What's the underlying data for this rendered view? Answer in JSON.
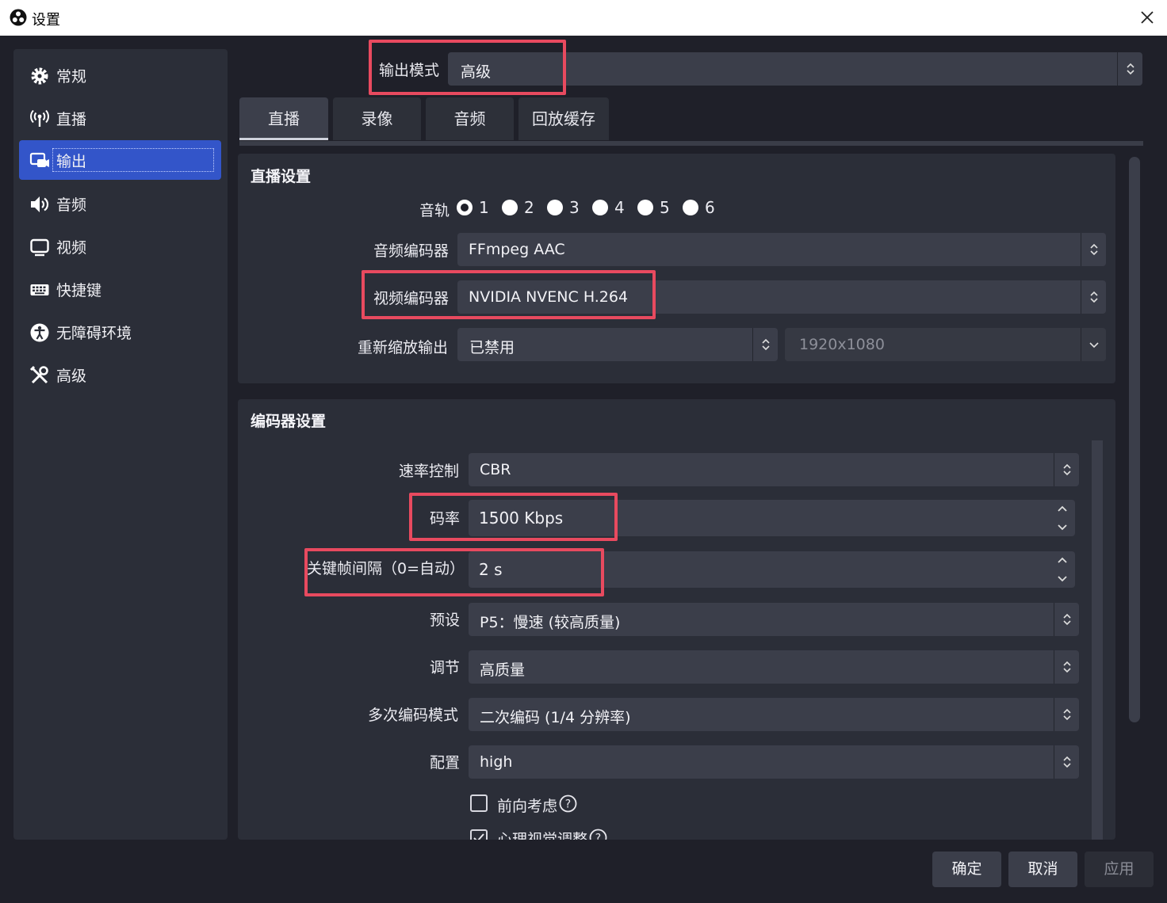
{
  "window": {
    "title": "设置"
  },
  "sidebar": {
    "items": [
      {
        "label": "常规"
      },
      {
        "label": "直播"
      },
      {
        "label": "输出"
      },
      {
        "label": "音频"
      },
      {
        "label": "视频"
      },
      {
        "label": "快捷键"
      },
      {
        "label": "无障碍环境"
      },
      {
        "label": "高级"
      }
    ]
  },
  "output_mode": {
    "label": "输出模式",
    "value": "高级"
  },
  "tabs": [
    {
      "label": "直播"
    },
    {
      "label": "录像"
    },
    {
      "label": "音频"
    },
    {
      "label": "回放缓存"
    }
  ],
  "stream_settings": {
    "title": "直播设置",
    "audio_track_label": "音轨",
    "tracks": [
      "1",
      "2",
      "3",
      "4",
      "5",
      "6"
    ],
    "audio_encoder": {
      "label": "音频编码器",
      "value": "FFmpeg AAC"
    },
    "video_encoder": {
      "label": "视频编码器",
      "value": "NVIDIA NVENC H.264"
    },
    "rescale": {
      "label": "重新缩放输出",
      "value": "已禁用",
      "resolution": "1920x1080"
    }
  },
  "encoder_settings": {
    "title": "编码器设置",
    "rate_control": {
      "label": "速率控制",
      "value": "CBR"
    },
    "bitrate": {
      "label": "码率",
      "value": "1500 Kbps"
    },
    "keyframe": {
      "label": "关键帧间隔（0=自动）",
      "value": "2 s"
    },
    "preset": {
      "label": "预设",
      "value": "P5：慢速 (较高质量)"
    },
    "tuning": {
      "label": "调节",
      "value": "高质量"
    },
    "multipass": {
      "label": "多次编码模式",
      "value": "二次编码 (1/4 分辨率)"
    },
    "profile": {
      "label": "配置",
      "value": "high"
    },
    "lookahead": {
      "label": "前向考虑"
    },
    "psycho": {
      "label": "心理视觉调整"
    }
  },
  "buttons": {
    "ok": "确定",
    "cancel": "取消",
    "apply": "应用"
  },
  "colors": {
    "accent": "#3355c9",
    "highlight": "#e84a5f",
    "background": "#1f2029",
    "panel": "#2b2e38",
    "field": "#3b3e4a"
  }
}
